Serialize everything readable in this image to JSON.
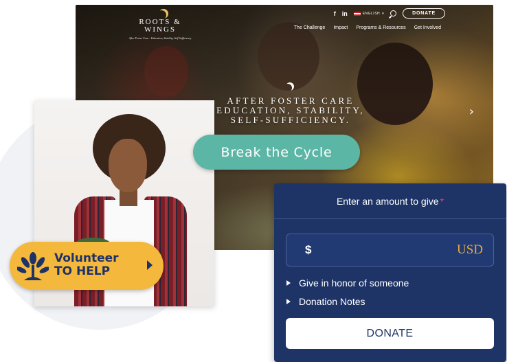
{
  "site": {
    "logo_name": "ROOTS & WINGS",
    "logo_tagline": "After Foster Care... Education, Stability, Self-Sufficiency",
    "social": {
      "facebook": "f",
      "linkedin": "in"
    },
    "language": "ENGLISH",
    "topbar_donate": "DONATE",
    "nav": [
      "The Challenge",
      "Impact",
      "Programs & Resources",
      "Get Involved"
    ],
    "hero_tagline_lines": [
      "AFTER FOSTER CARE",
      "EDUCATION, STABILITY,",
      "SELF-SUFFICIENCY."
    ],
    "hero_next_icon": "chevron-right-icon"
  },
  "cta": {
    "break_cycle": "Break the Cycle",
    "volunteer_line1": "Volunteer",
    "volunteer_line2": "TO HELP"
  },
  "donation": {
    "heading": "Enter an amount to give",
    "required_marker": "*",
    "currency_symbol": "$",
    "currency_code": "USD",
    "amount_value": "",
    "options": [
      "Give in honor of someone",
      "Donation Notes"
    ],
    "submit_label": "DONATE"
  },
  "colors": {
    "navy": "#1e3366",
    "teal": "#5cb6a6",
    "gold": "#f3b83c",
    "usd_accent": "#e7a83a"
  }
}
